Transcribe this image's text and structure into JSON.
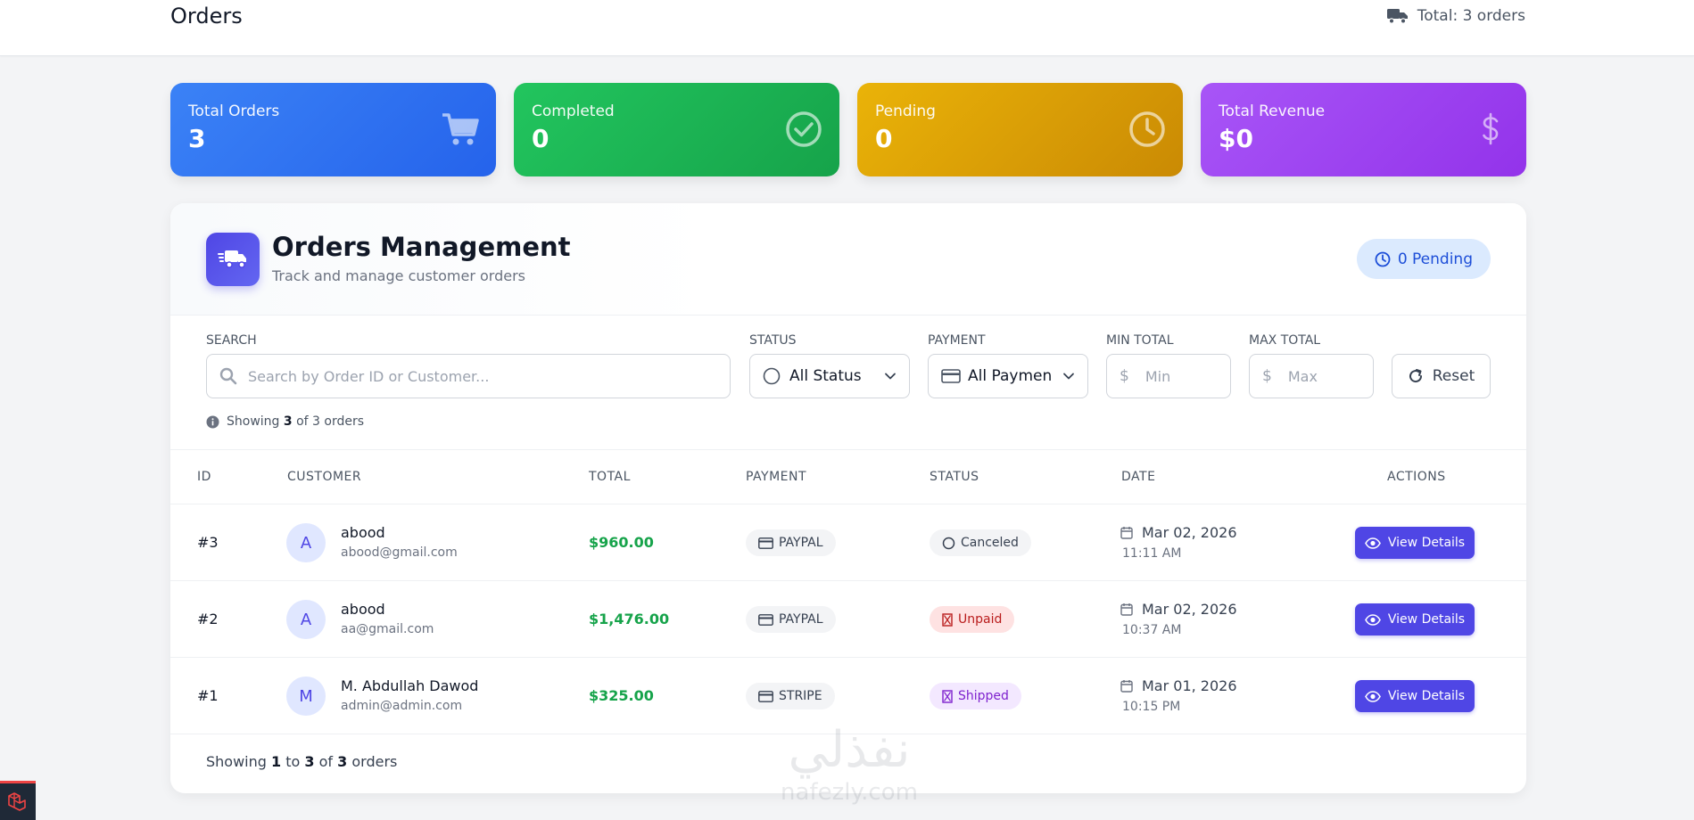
{
  "header": {
    "title": "Orders",
    "total_text": "Total: 3 orders"
  },
  "stats": [
    {
      "label": "Total Orders",
      "value": "3",
      "icon": "cart-icon",
      "color": "#3b82f6"
    },
    {
      "label": "Completed",
      "value": "0",
      "icon": "check-circle-icon",
      "color": "#22c55e"
    },
    {
      "label": "Pending",
      "value": "0",
      "icon": "clock-icon",
      "color": "#eab308"
    },
    {
      "label": "Total Revenue",
      "value": "$0",
      "icon": "dollar-icon",
      "color": "#a855f7"
    }
  ],
  "management": {
    "title": "Orders Management",
    "subtitle": "Track and manage customer orders",
    "pending_badge": "0 Pending"
  },
  "filters": {
    "search_label": "SEARCH",
    "search_placeholder": "Search by Order ID or Customer...",
    "status_label": "STATUS",
    "status_value": "All Status",
    "payment_label": "PAYMENT",
    "payment_value": "All Paymen",
    "min_label": "MIN TOTAL",
    "min_placeholder": "Min",
    "max_label": "MAX TOTAL",
    "max_placeholder": "Max",
    "currency_symbol": "$",
    "reset_label": "Reset",
    "showing_prefix": "Showing",
    "showing_count": "3",
    "showing_suffix": "of 3 orders"
  },
  "table": {
    "headers": [
      "ID",
      "CUSTOMER",
      "TOTAL",
      "PAYMENT",
      "STATUS",
      "DATE",
      "ACTIONS"
    ],
    "rows": [
      {
        "id": "#3",
        "initial": "A",
        "name": "abood",
        "email": "abood@gmail.com",
        "total": "$960.00",
        "payment": "PAYPAL",
        "status": "Canceled",
        "date": "Mar 02, 2026",
        "time": "11:11 AM",
        "action": "View Details"
      },
      {
        "id": "#2",
        "initial": "A",
        "name": "abood",
        "email": "aa@gmail.com",
        "total": "$1,476.00",
        "payment": "PAYPAL",
        "status": "Unpaid",
        "date": "Mar 02, 2026",
        "time": "10:37 AM",
        "action": "View Details"
      },
      {
        "id": "#1",
        "initial": "M",
        "name": "M. Abdullah Dawod",
        "email": "admin@admin.com",
        "total": "$325.00",
        "payment": "STRIPE",
        "status": "Shipped",
        "date": "Mar 01, 2026",
        "time": "10:15 PM",
        "action": "View Details"
      }
    ]
  },
  "footer": {
    "showing": "Showing",
    "from": "1",
    "to_word": "to",
    "to": "3",
    "of_word": "of",
    "total": "3",
    "orders_word": "orders"
  },
  "watermark": {
    "arabic": "نفذلي",
    "latin": "nafezly.com"
  },
  "colors": {
    "accent": "#4f46e5",
    "money": "#16a34a",
    "unpaid": "#b91c1c",
    "shipped": "#7e22ce"
  }
}
